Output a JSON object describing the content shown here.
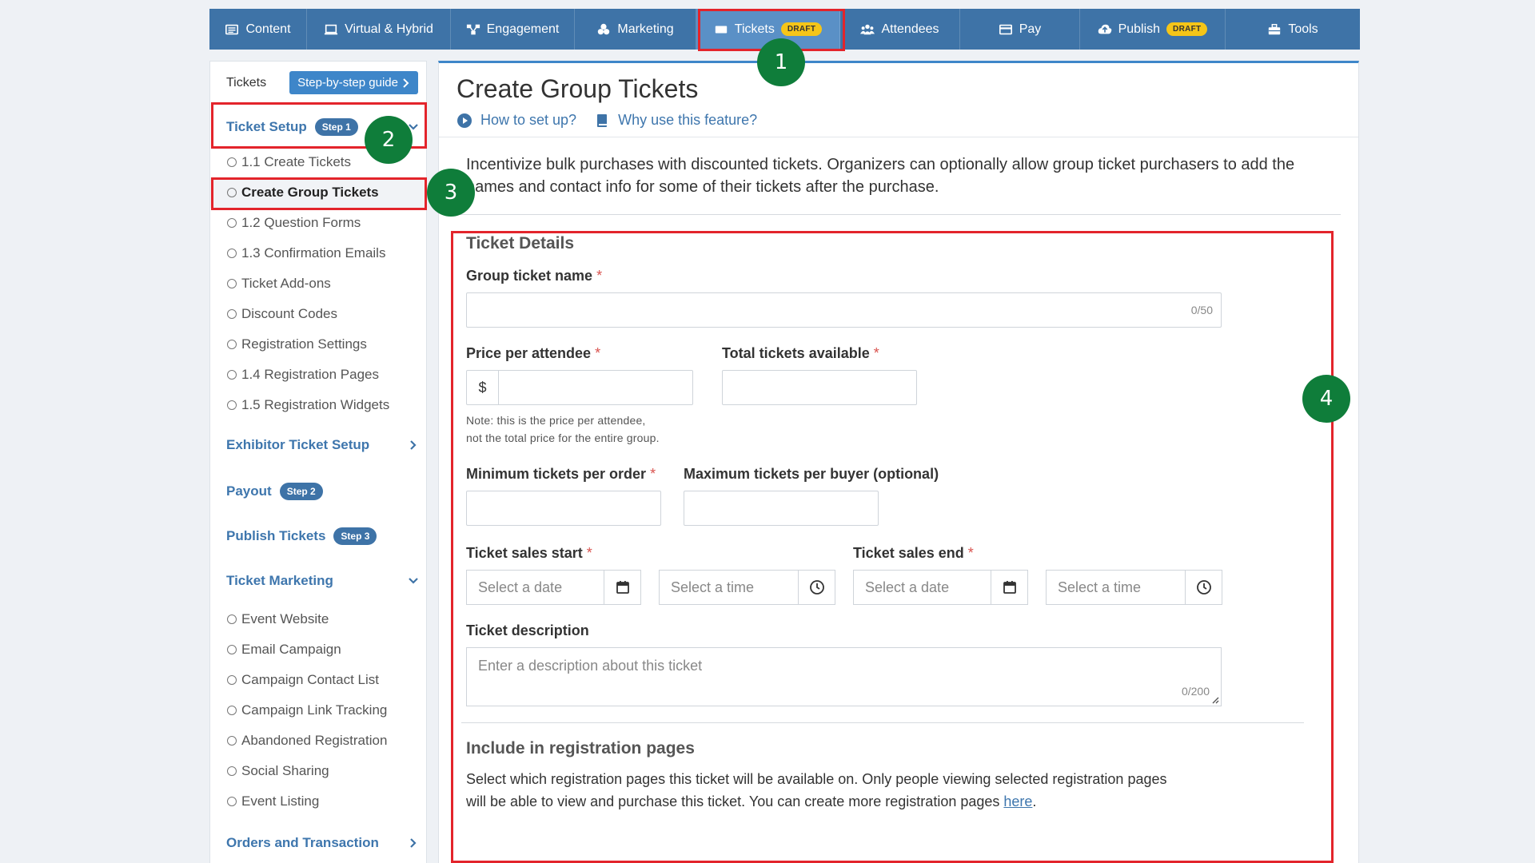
{
  "nav": {
    "items": [
      {
        "label": "Content",
        "icon": "content-icon",
        "badge": ""
      },
      {
        "label": "Virtual & Hybrid",
        "icon": "monitor-icon",
        "badge": ""
      },
      {
        "label": "Engagement",
        "icon": "network-icon",
        "badge": ""
      },
      {
        "label": "Marketing",
        "icon": "marketing-icon",
        "badge": ""
      },
      {
        "label": "Tickets",
        "icon": "ticket-icon",
        "badge": "DRAFT"
      },
      {
        "label": "Attendees",
        "icon": "users-icon",
        "badge": ""
      },
      {
        "label": "Pay",
        "icon": "card-icon",
        "badge": ""
      },
      {
        "label": "Publish",
        "icon": "cloud-upload-icon",
        "badge": "DRAFT"
      },
      {
        "label": "Tools",
        "icon": "toolbox-icon",
        "badge": ""
      }
    ]
  },
  "sidebar": {
    "header": "Tickets",
    "guide_button": "Step-by-step guide",
    "ticket_setup": {
      "label": "Ticket Setup",
      "step": "Step 1"
    },
    "setup_items": [
      "1.1 Create Tickets",
      "Create Group Tickets",
      "1.2 Question Forms",
      "1.3 Confirmation Emails",
      "Ticket Add-ons",
      "Discount Codes",
      "Registration Settings",
      "1.4 Registration Pages",
      "1.5 Registration Widgets"
    ],
    "exhibitor": "Exhibitor Ticket Setup",
    "payout": {
      "label": "Payout",
      "step": "Step 2"
    },
    "publish": {
      "label": "Publish Tickets",
      "step": "Step 3"
    },
    "marketing": {
      "label": "Ticket Marketing"
    },
    "marketing_items": [
      "Event Website",
      "Email Campaign",
      "Campaign Contact List",
      "Campaign Link Tracking",
      "Abandoned Registration",
      "Social Sharing",
      "Event Listing"
    ],
    "orders": "Orders and Transaction"
  },
  "main": {
    "title": "Create Group Tickets",
    "link_setup": "How to set up?",
    "link_why": "Why use this feature?",
    "intro": "Incentivize bulk purchases with discounted tickets. Organizers can optionally allow group ticket purchasers to add the names and contact info for some of their tickets after the purchase.",
    "section_details": "Ticket Details",
    "group_name_label": "Group ticket name",
    "group_name_counter": "0/50",
    "price_label": "Price per attendee",
    "currency": "$",
    "total_label": "Total tickets available",
    "price_note_1": "Note: this is the price per attendee,",
    "price_note_2": "not the total price for the entire group.",
    "min_label": "Minimum tickets per order",
    "max_label": "Maximum tickets per buyer (optional)",
    "start_label": "Ticket sales start",
    "end_label": "Ticket sales end",
    "date_placeholder": "Select a date",
    "time_placeholder": "Select a time",
    "desc_label": "Ticket description",
    "desc_placeholder": "Enter a description about this ticket",
    "desc_counter": "0/200",
    "section_reg": "Include in registration pages",
    "reg_text": "Select which registration pages this ticket will be available on. Only people viewing selected registration pages will be able to view and purchase this ticket. You can create more registration pages ",
    "reg_link": "here",
    "reg_end": ".",
    "required_mark": "*"
  },
  "annotations": {
    "m1": "1",
    "m2": "2",
    "m3": "3",
    "m4": "4"
  },
  "colors": {
    "nav": "#3e73a7",
    "accent": "#3e86c9",
    "highlight": "#e3242b",
    "marker": "#0f7d3a",
    "draft": "#f5c518"
  }
}
